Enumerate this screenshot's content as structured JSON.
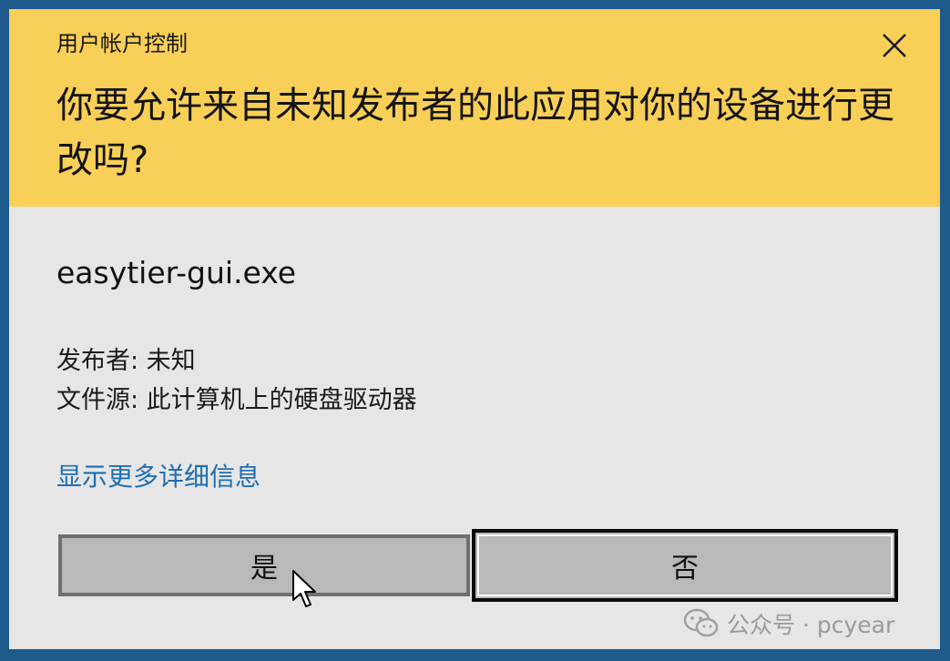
{
  "dialog": {
    "app_title": "用户帐户控制",
    "question": "你要允许来自未知发布者的此应用对你的设备进行更改吗?",
    "program_name": "easytier-gui.exe",
    "publisher": "发布者: 未知",
    "file_source": "文件源: 此计算机上的硬盘驱动器",
    "details_link": "显示更多详细信息",
    "yes_label": "是",
    "no_label": "否",
    "close_icon": "close-icon",
    "header_color": "#f8cf57",
    "body_color": "#e6e6e6",
    "link_color": "#1f6eb0"
  },
  "watermark": {
    "text": "公众号 · pcyear",
    "icon": "wechat-icon"
  }
}
